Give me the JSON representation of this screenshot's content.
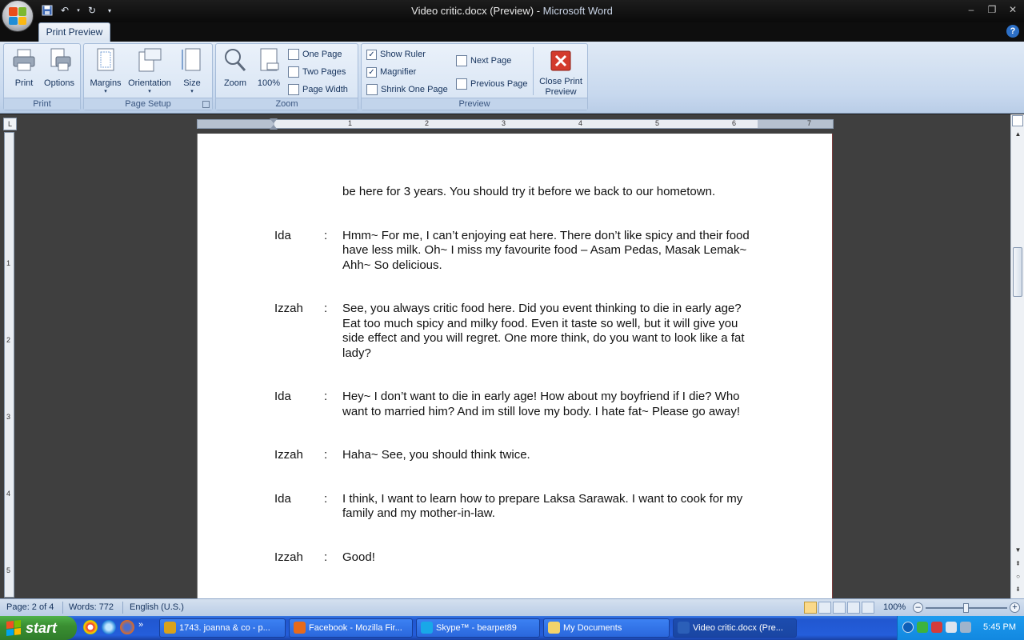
{
  "window": {
    "title": "Video critic.docx (Preview)",
    "app_name": "Microsoft Word",
    "title_separator": " - "
  },
  "tabs": [
    {
      "label": "Print Preview",
      "active": true
    }
  ],
  "ribbon": {
    "groups": {
      "print": {
        "label": "Print",
        "print_btn": "Print",
        "options_btn": "Options"
      },
      "page_setup": {
        "label": "Page Setup",
        "margins_btn": "Margins",
        "orientation_btn": "Orientation",
        "size_btn": "Size"
      },
      "zoom": {
        "label": "Zoom",
        "zoom_btn": "Zoom",
        "pct_btn": "100%",
        "one_page": "One Page",
        "two_pages": "Two Pages",
        "page_width": "Page Width"
      },
      "preview": {
        "label": "Preview",
        "show_ruler": "Show Ruler",
        "show_ruler_checked": true,
        "magnifier": "Magnifier",
        "magnifier_checked": true,
        "shrink_one_page": "Shrink One Page",
        "next_page": "Next Page",
        "previous_page": "Previous Page",
        "close_line1": "Close Print",
        "close_line2": "Preview"
      }
    }
  },
  "ruler": {
    "h_ticks": [
      "1",
      "2",
      "3",
      "4",
      "5",
      "6",
      "7"
    ],
    "v_ticks": [
      "1",
      "2",
      "3",
      "4",
      "5"
    ],
    "tab_stop_symbol": "L"
  },
  "document": {
    "continuation": "be here for 3 years. You should try it before we back to our hometown.",
    "lines": [
      {
        "speaker": "Ida",
        "colon": ":",
        "text": "Hmm~ For me, I can’t enjoying eat here. There don’t like spicy and their food have less milk. Oh~ I miss my favourite food – Asam Pedas, Masak Lemak~ Ahh~ So delicious."
      },
      {
        "speaker": "Izzah",
        "colon": ":",
        "text": "See, you always critic food here. Did you event thinking to die in early age? Eat too much spicy and milky food. Even it taste so well, but it will give you side effect and you will regret. One more think, do you want to look like a fat lady?"
      },
      {
        "speaker": "Ida",
        "colon": ":",
        "text": "Hey~ I don’t want to die in early age! How about my boyfriend if I die? Who want to married him? And im still love my body. I hate fat~ Please go away!"
      },
      {
        "speaker": "Izzah",
        "colon": ":",
        "text": "Haha~ See, you should think twice."
      },
      {
        "speaker": "Ida",
        "colon": ":",
        "text": "I think, I want to learn how to prepare Laksa Sarawak. I want to cook for my family and my mother-in-law."
      },
      {
        "speaker": "Izzah",
        "colon": ":",
        "text": "Good!"
      }
    ]
  },
  "status": {
    "page": "Page: 2 of 4",
    "words": "Words: 772",
    "language": "English (U.S.)",
    "zoom": "100%",
    "zoom_level_fraction": 0.5
  },
  "taskbar": {
    "start": "start",
    "tasks": [
      {
        "label": "1743. joanna & co - p...",
        "icon_color": "#d9a21b",
        "active": false
      },
      {
        "label": "Facebook - Mozilla Fir...",
        "icon_color": "#e66a1b",
        "active": false
      },
      {
        "label": "Skype™ - bearpet89",
        "icon_color": "#19a8e8",
        "active": false
      },
      {
        "label": "My Documents",
        "icon_color": "#f2d36b",
        "active": false
      },
      {
        "label": "Video critic.docx (Pre...",
        "icon_color": "#2b5fb8",
        "active": true
      }
    ],
    "clock": "5:45 PM"
  },
  "colors": {
    "ribbon_bg": "#dfe9f5",
    "taskbar_blue": "#245edb",
    "start_green": "#3a8f32",
    "close_red": "#d33b2c"
  }
}
